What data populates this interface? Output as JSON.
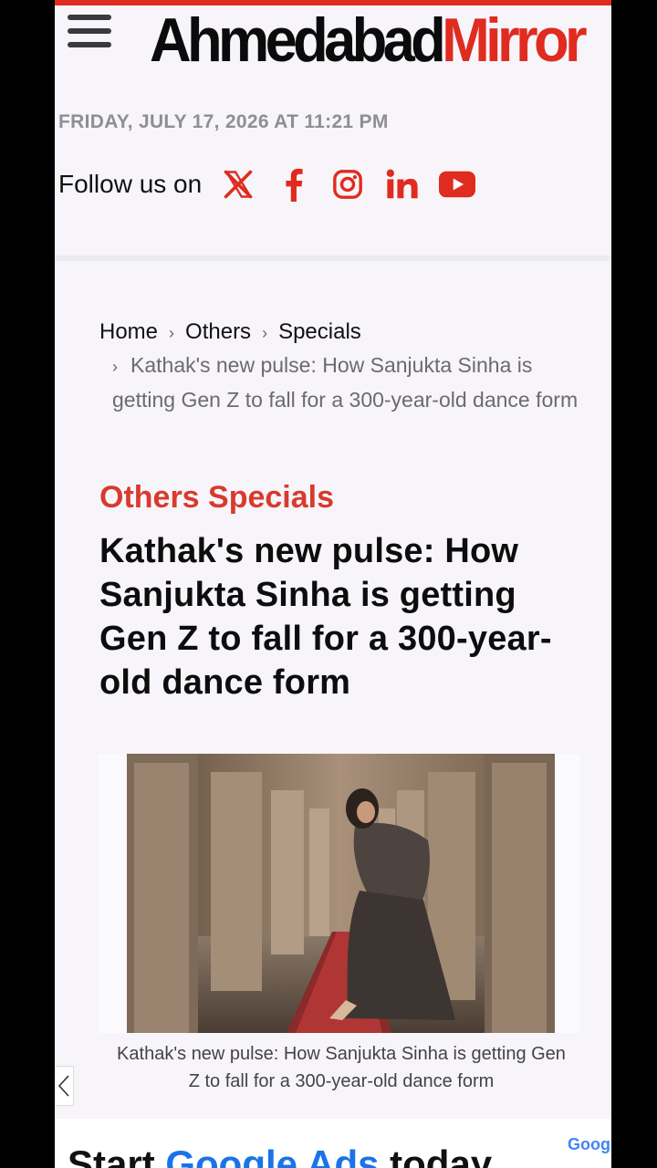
{
  "header": {
    "logo_part1": "Ahmedabad",
    "logo_part2": "Mirror",
    "date": "FRIDAY, JULY 17, 2026 AT 11:21 PM",
    "follow_label": "Follow us on",
    "social_icons": [
      "x-icon",
      "facebook-icon",
      "instagram-icon",
      "linkedin-icon",
      "youtube-icon"
    ]
  },
  "breadcrumb": {
    "home": "Home",
    "others": "Others",
    "specials": "Specials",
    "separator": "›",
    "current": "Kathak's new pulse: How Sanjukta Sinha is getting Gen Z to fall for a 300-year-old dance form"
  },
  "article": {
    "category": "Others Specials",
    "headline": "Kathak's new pulse: How Sanjukta Sinha is getting Gen Z to fall for a 300-year-old dance form",
    "caption": "Kathak's new pulse: How Sanjukta Sinha is getting Gen Z to fall for a 300-year-old dance form"
  },
  "ad": {
    "text_start": "Start ",
    "text_brand": "Google Ads",
    "text_end": " today",
    "logo": "Goog"
  },
  "colors": {
    "accent": "#e02b20",
    "category": "#d83a2e"
  }
}
